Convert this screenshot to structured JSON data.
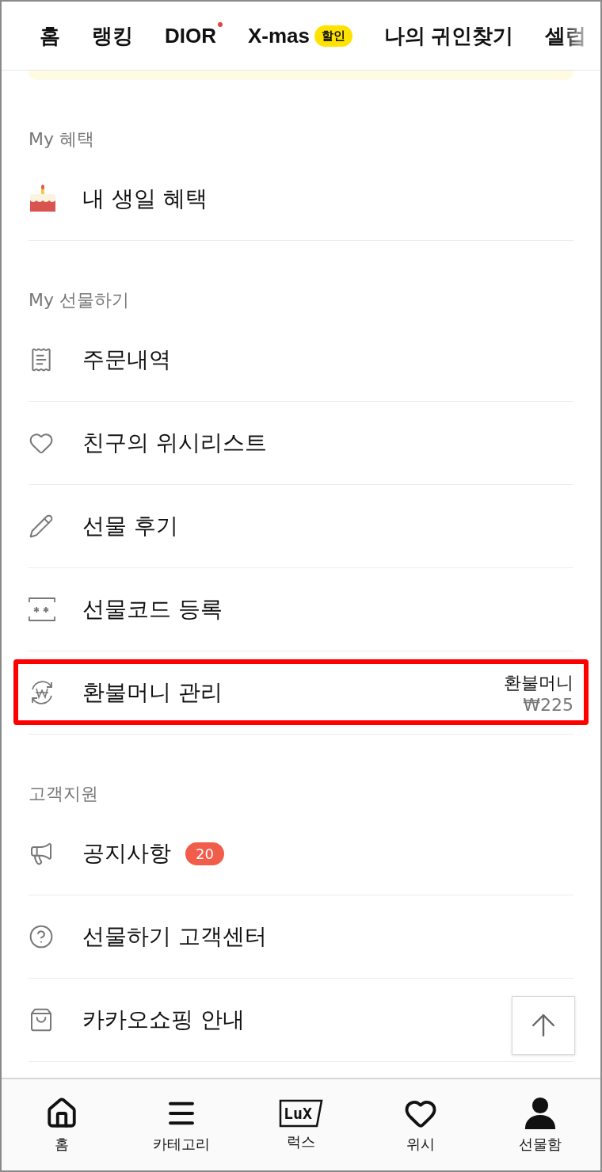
{
  "top_tabs": [
    {
      "label": "홈"
    },
    {
      "label": "랭킹"
    },
    {
      "label": "DIOR",
      "dot": true
    },
    {
      "label": "X-mas",
      "badge": "할인"
    },
    {
      "label": "나의 귀인찾기"
    },
    {
      "label": "셀럽"
    }
  ],
  "sections": [
    {
      "title": "My 혜택",
      "items": [
        {
          "label": "내 생일 혜택"
        }
      ]
    },
    {
      "title": "My 선물하기",
      "items": [
        {
          "label": "주문내역"
        },
        {
          "label": "친구의 위시리스트"
        },
        {
          "label": "선물 후기"
        },
        {
          "label": "선물코드 등록"
        },
        {
          "label": "환불머니 관리",
          "side_label": "환불머니",
          "side_value": "₩225",
          "highlighted": true
        }
      ]
    },
    {
      "title": "고객지원",
      "items": [
        {
          "label": "공지사항",
          "badge": "20"
        },
        {
          "label": "선물하기 고객센터"
        },
        {
          "label": "카카오쇼핑 안내"
        }
      ]
    }
  ],
  "bottom_nav": [
    {
      "label": "홈",
      "selected": false
    },
    {
      "label": "카테고리",
      "selected": false
    },
    {
      "label": "럭스",
      "selected": false,
      "logo": "LuX"
    },
    {
      "label": "위시",
      "selected": false
    },
    {
      "label": "선물함",
      "selected": true
    }
  ]
}
